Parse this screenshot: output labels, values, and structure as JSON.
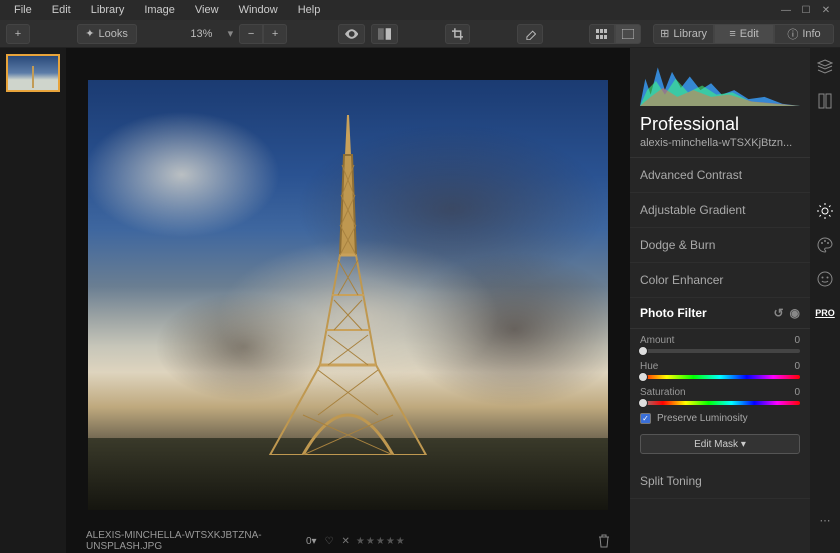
{
  "menu": {
    "items": [
      "File",
      "Edit",
      "Library",
      "Image",
      "View",
      "Window",
      "Help"
    ]
  },
  "toolbar": {
    "looks_label": "Looks",
    "zoom_pct": "13%",
    "mode_library": "Library",
    "mode_edit": "Edit",
    "mode_info": "Info"
  },
  "footer": {
    "filename": "ALEXIS-MINCHELLA-WTSXKJBTZNA-UNSPLASH.JPG",
    "rating_label": "0"
  },
  "right": {
    "preset_title": "Professional",
    "preset_sub": "alexis-minchella-wTSXKjBtzn...",
    "panels": [
      "Advanced Contrast",
      "Adjustable Gradient",
      "Dodge & Burn",
      "Color Enhancer"
    ],
    "active_panel": "Photo Filter",
    "amount_label": "Amount",
    "amount_value": "0",
    "hue_label": "Hue",
    "hue_value": "0",
    "sat_label": "Saturation",
    "sat_value": "0",
    "preserve_label": "Preserve Luminosity",
    "edit_mask": "Edit Mask ▾",
    "panel_after": "Split Toning",
    "pro_badge": "PRO"
  }
}
